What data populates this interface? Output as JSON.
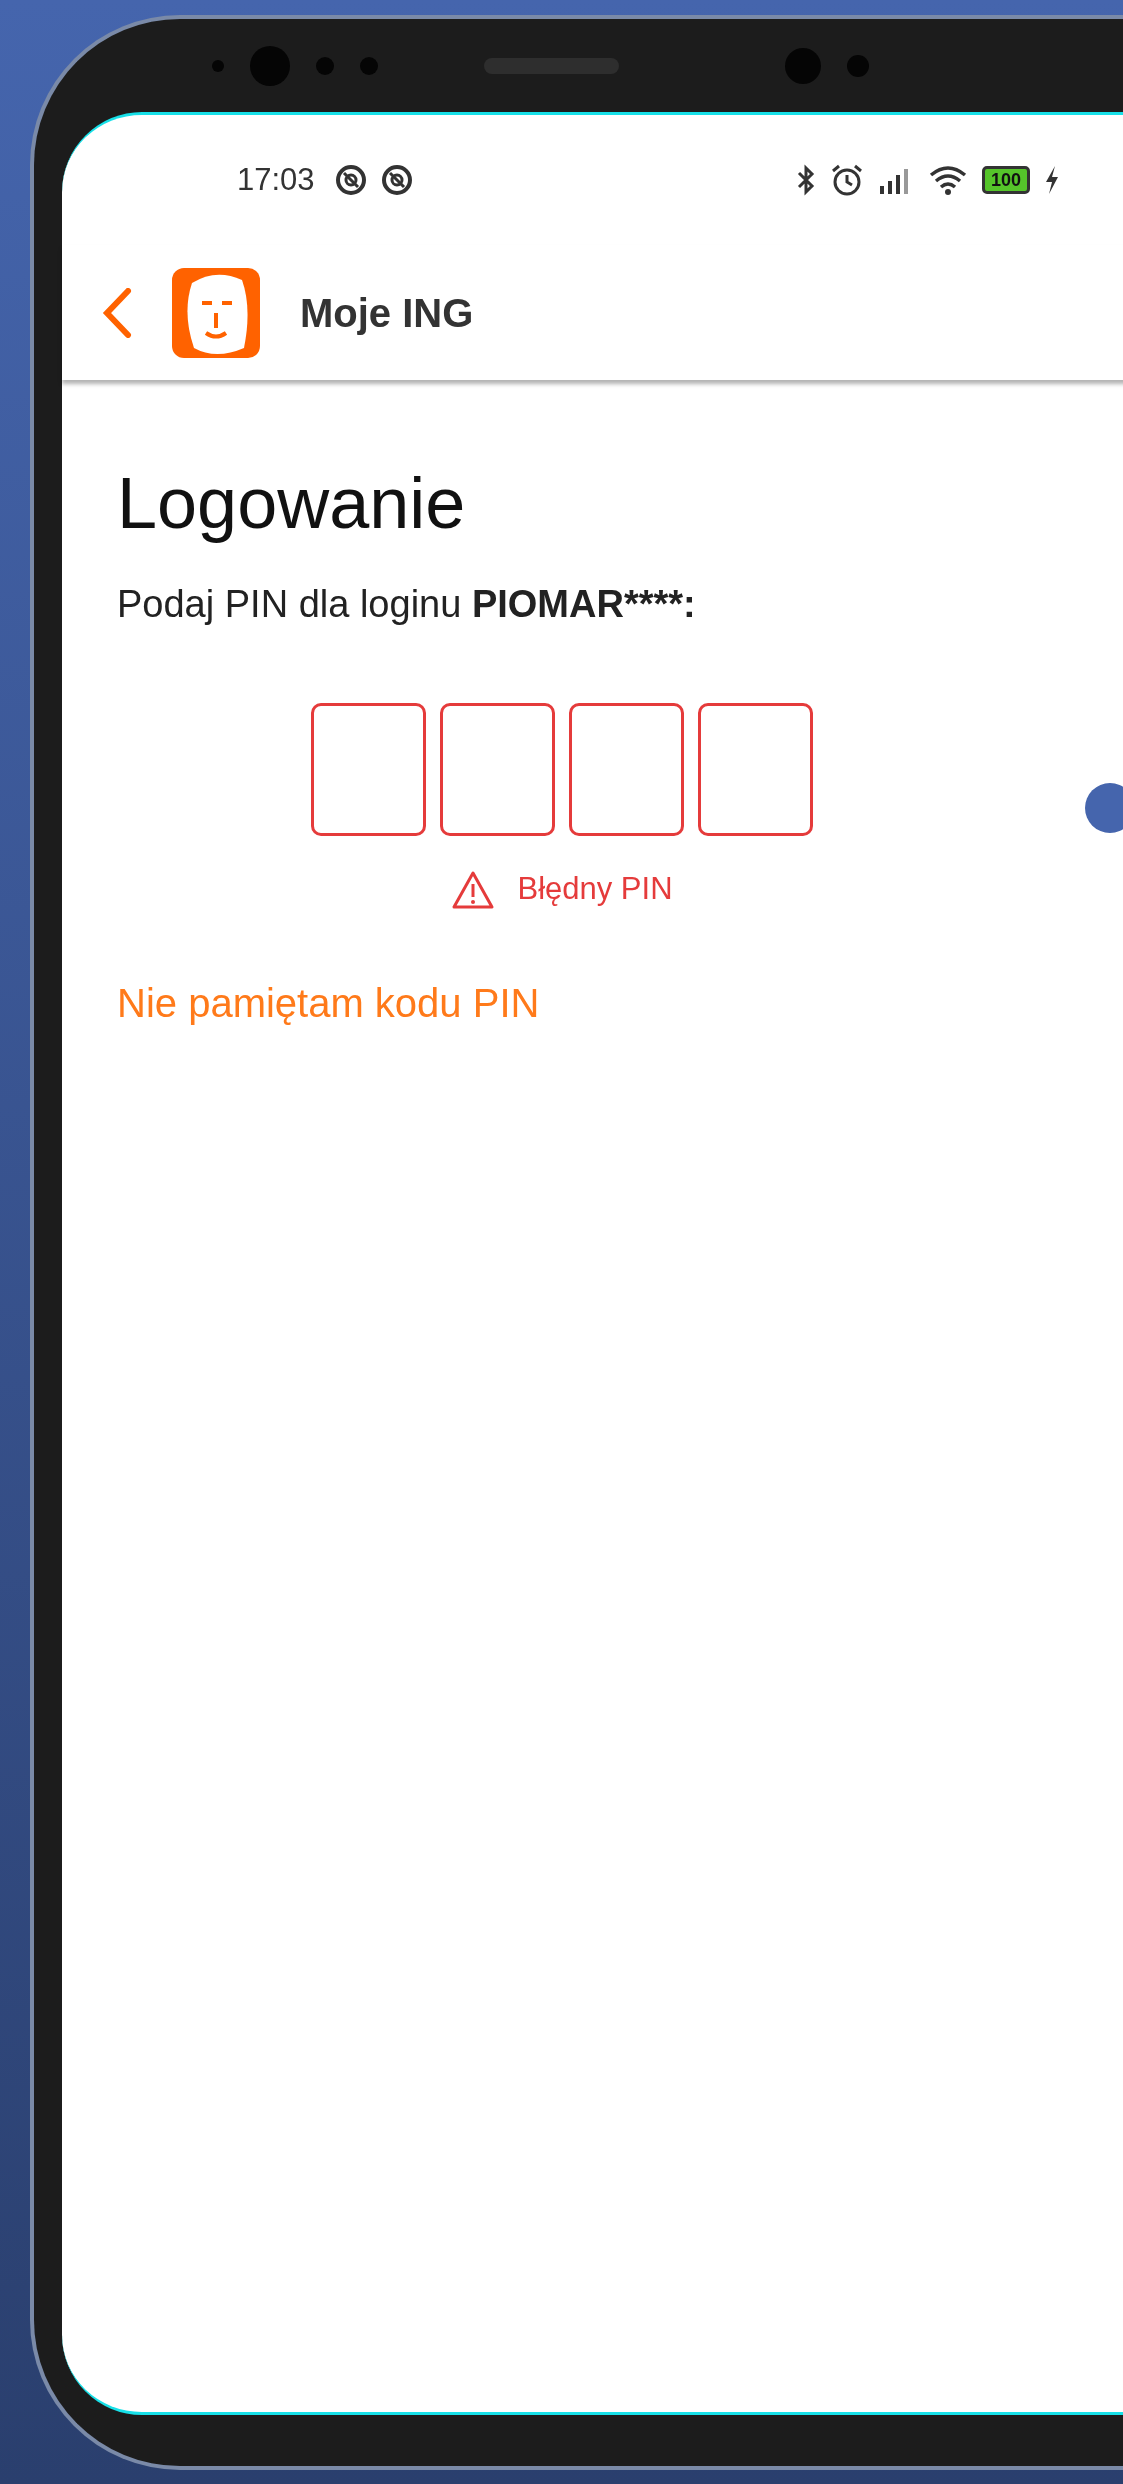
{
  "status_bar": {
    "time": "17:03",
    "battery": "100"
  },
  "header": {
    "title": "Moje ING"
  },
  "heading": "Logowanie",
  "prompt": {
    "text": "Podaj PIN dla loginu",
    "login": "PIOMAR****:"
  },
  "pin_boxes": [
    {
      "error": true
    },
    {
      "error": true
    },
    {
      "error": true
    },
    {
      "error": true
    }
  ],
  "error_message": "Błędny PIN",
  "forgot_link": "Nie pamiętam kodu PIN"
}
